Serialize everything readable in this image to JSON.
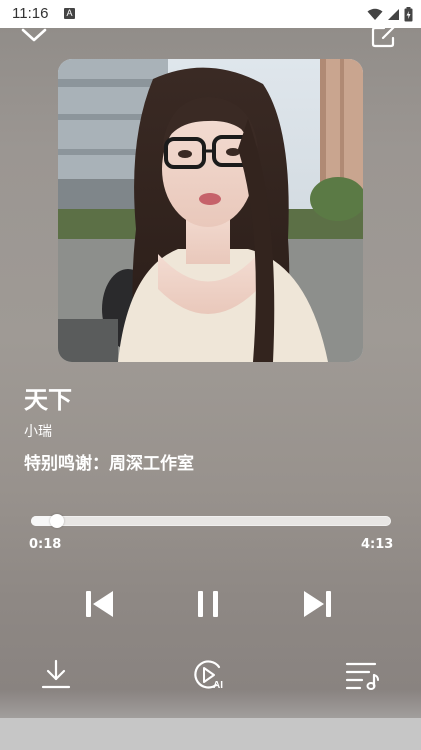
{
  "status_bar": {
    "time": "11:16",
    "notification_icon": "a-letter-icon",
    "icons": [
      "wifi-icon",
      "signal-icon",
      "battery-icon"
    ]
  },
  "header": {
    "collapse_icon": "chevron-down-icon",
    "share_icon": "share-external-icon"
  },
  "song": {
    "title": "天下",
    "artist": "小瑞",
    "credit": "特别鸣谢：周深工作室"
  },
  "progress": {
    "current_time": "0:18",
    "total_time": "4:13",
    "fraction": 0.071
  },
  "controls": {
    "previous_icon": "skip-previous-icon",
    "pause_icon": "pause-icon",
    "next_icon": "skip-next-icon",
    "download_icon": "download-icon",
    "ai_icon": "ai-play-icon",
    "ai_label": "AI",
    "playlist_icon": "playlist-icon"
  },
  "colors": {
    "accent": "#ffffff",
    "track": "#e8e6e4"
  }
}
